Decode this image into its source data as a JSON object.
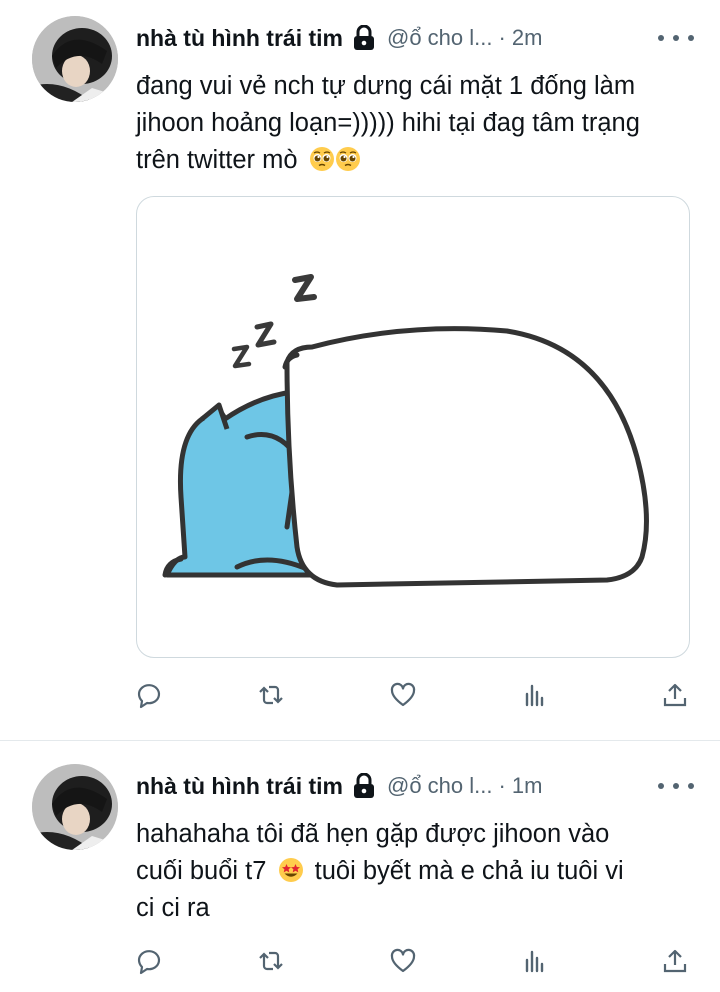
{
  "tweets": [
    {
      "author_name": "nhà tù hình trái tim",
      "handle": "@ổ cho l...",
      "separator": "·",
      "time": "2m",
      "text_lines": [
        "đang vui vẻ nch tự dưng cái mặt 1 đống làm",
        "jihoon hoảng loạn=))))) hihi tại đag tâm trạng",
        "trên twitter mò"
      ],
      "emojis": [
        "pleading-face",
        "pleading-face"
      ],
      "media": "sleeping-blue-cat-under-blanket-illustration"
    },
    {
      "author_name": "nhà tù hình trái tim",
      "handle": "@ổ cho l...",
      "separator": "·",
      "time": "1m",
      "text_lines": [
        "hahahaha tôi đã hẹn gặp được jihoon vào",
        "cuối buổi t7",
        "tuôi byết mà e chả iu tuôi vi",
        "ci ci ra"
      ],
      "emojis": [
        "star-struck"
      ]
    }
  ],
  "actions": [
    "reply-icon",
    "retweet-icon",
    "like-icon",
    "views-icon",
    "share-icon"
  ],
  "colors": {
    "text": "#0f1419",
    "secondary": "#536471",
    "border": "#cfd9de",
    "cat_blue": "#6ec6e6"
  }
}
